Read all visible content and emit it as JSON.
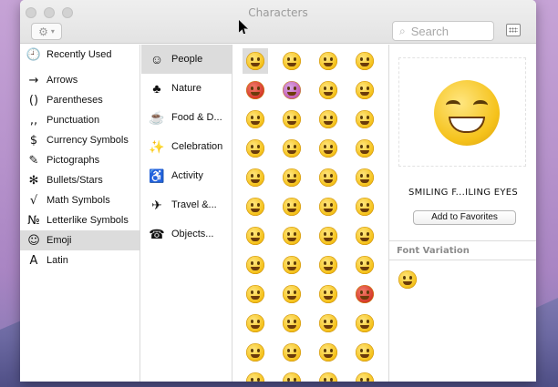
{
  "window": {
    "title": "Characters"
  },
  "toolbar": {
    "action_icon": "gear-icon",
    "search_placeholder": "Search",
    "keyboard_icon": "keyboard-viewer-icon"
  },
  "categories": [
    {
      "glyph": "🕘",
      "label": "Recently Used"
    },
    {
      "glyph": "→",
      "label": "Arrows"
    },
    {
      "glyph": "()",
      "label": "Parentheses"
    },
    {
      "glyph": ",,",
      "label": "Punctuation"
    },
    {
      "glyph": "$",
      "label": "Currency Symbols"
    },
    {
      "glyph": "✎",
      "label": "Pictographs"
    },
    {
      "glyph": "✻",
      "label": "Bullets/Stars"
    },
    {
      "glyph": "√",
      "label": "Math Symbols"
    },
    {
      "glyph": "№",
      "label": "Letterlike Symbols"
    },
    {
      "glyph": "☺",
      "label": "Emoji"
    },
    {
      "glyph": "A",
      "label": "Latin"
    }
  ],
  "selected_category": "Emoji",
  "subcategories": [
    {
      "glyph": "☺",
      "label": "People"
    },
    {
      "glyph": "♣",
      "label": "Nature"
    },
    {
      "glyph": "☕",
      "label": "Food & D..."
    },
    {
      "glyph": "✨",
      "label": "Celebration"
    },
    {
      "glyph": "♿",
      "label": "Activity"
    },
    {
      "glyph": "✈",
      "label": "Travel &..."
    },
    {
      "glyph": "☎",
      "label": "Objects..."
    }
  ],
  "selected_subcategory": "People",
  "emoji_grid": {
    "columns": 4,
    "rows": 12,
    "selected_index": 0,
    "special_colors": {
      "4": "red",
      "5": "purple",
      "35": "red"
    }
  },
  "detail": {
    "character_name": "SMILING F...ILING EYES",
    "add_favorites_label": "Add to Favorites",
    "font_variation_label": "Font Variation"
  }
}
